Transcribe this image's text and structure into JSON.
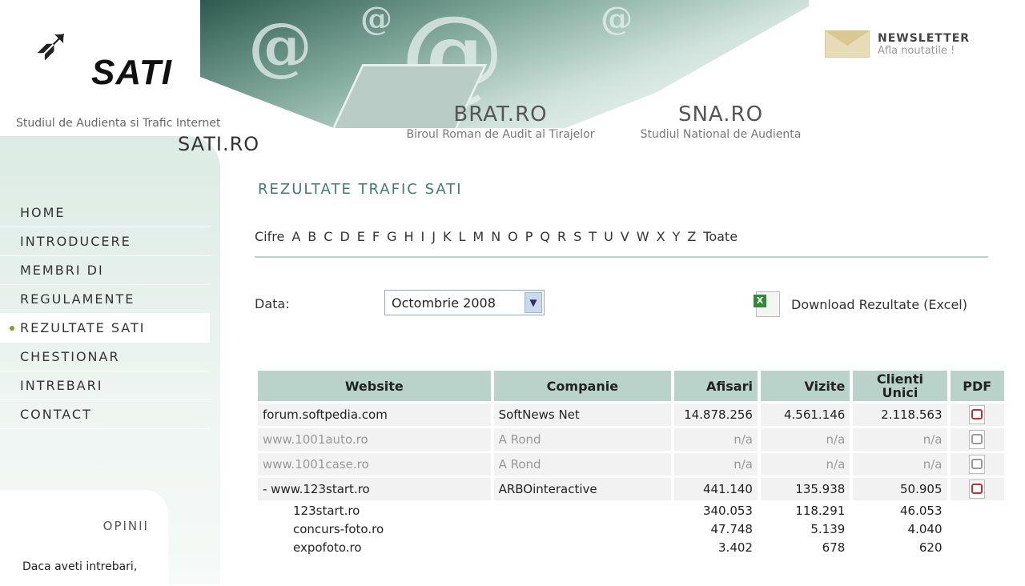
{
  "header": {
    "logo_text": "SATI",
    "tagline": "Studiul de Audienta si Trafic Internet",
    "site": "SATI.RO",
    "brat": {
      "title": "BRAT.RO",
      "subtitle": "Biroul Roman de Audit al Tirajelor"
    },
    "sna": {
      "title": "SNA.RO",
      "subtitle": "Studiul National de Audienta"
    },
    "newsletter": {
      "title": "NEWSLETTER",
      "subtitle": "Afla noutatile !"
    }
  },
  "nav": {
    "items": [
      {
        "label": "HOME"
      },
      {
        "label": "INTRODUCERE"
      },
      {
        "label": "MEMBRI DI"
      },
      {
        "label": "REGULAMENTE"
      },
      {
        "label": "REZULTATE SATI"
      },
      {
        "label": "CHESTIONAR"
      },
      {
        "label": "INTREBARI"
      },
      {
        "label": "CONTACT"
      }
    ],
    "active": "REZULTATE SATI"
  },
  "opinii": {
    "title": "OPINII",
    "text": "Daca aveti intrebari,"
  },
  "main": {
    "title": "REZULTATE TRAFIC SATI",
    "alphabet": [
      "Cifre",
      "A",
      "B",
      "C",
      "D",
      "E",
      "F",
      "G",
      "H",
      "I",
      "J",
      "K",
      "L",
      "M",
      "N",
      "O",
      "P",
      "Q",
      "R",
      "S",
      "T",
      "U",
      "V",
      "W",
      "X",
      "Y",
      "Z",
      "Toate"
    ],
    "data_label": "Data:",
    "date_select": "Octombrie 2008",
    "download": "Download Rezultate (Excel)"
  },
  "table": {
    "headers": [
      "Website",
      "Companie",
      "Afisari",
      "Vizite",
      "Clienti Unici",
      "PDF"
    ],
    "rows": [
      {
        "site": "forum.softpedia.com",
        "company": "SoftNews Net",
        "afisari": "14.878.256",
        "vizite": "4.561.146",
        "clienti": "2.118.563"
      },
      {
        "site": "www.1001auto.ro",
        "company": "A Rond",
        "afisari": "n/a",
        "vizite": "n/a",
        "clienti": "n/a"
      },
      {
        "site": "www.1001case.ro",
        "company": "A Rond",
        "afisari": "n/a",
        "vizite": "n/a",
        "clienti": "n/a"
      },
      {
        "site": "- www.123start.ro",
        "company": "ARBOinteractive",
        "afisari": "441.140",
        "vizite": "135.938",
        "clienti": "50.905"
      }
    ],
    "subrows": [
      {
        "site": "123start.ro",
        "afisari": "340.053",
        "vizite": "118.291",
        "clienti": "46.053"
      },
      {
        "site": "concurs-foto.ro",
        "afisari": "47.748",
        "vizite": "5.139",
        "clienti": "4.040"
      },
      {
        "site": "expofoto.ro",
        "afisari": "3.402",
        "vizite": "678",
        "clienti": "620"
      }
    ]
  }
}
